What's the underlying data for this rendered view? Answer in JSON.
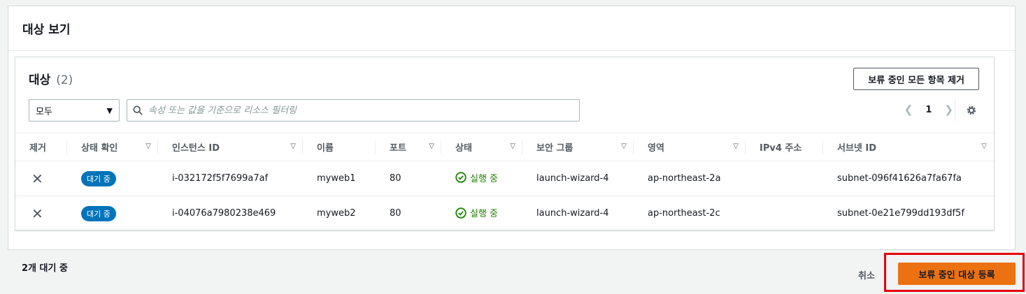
{
  "section": {
    "title": "대상 보기"
  },
  "targets": {
    "title": "대상",
    "count": "(2)",
    "remove_all_label": "보류 중인 모든 항목 제거",
    "filter_select": "모두",
    "search_placeholder": "속성 또는 값을 기준으로 리소스 필터링",
    "page": "1",
    "columns": [
      "제거",
      "상태 확인",
      "인스턴스 ID",
      "이름",
      "포트",
      "상태",
      "보안 그룹",
      "영역",
      "IPv4 주소",
      "서브넷 ID"
    ],
    "rows": [
      {
        "health": "대기 중",
        "instance_id": "i-032172f5f7699a7af",
        "name": "myweb1",
        "port": "80",
        "state": "실행 중",
        "security_group": "launch-wizard-4",
        "zone": "ap-northeast-2a",
        "ipv4": "",
        "subnet": "subnet-096f41626a7fa67fa"
      },
      {
        "health": "대기 중",
        "instance_id": "i-04076a7980238e469",
        "name": "myweb2",
        "port": "80",
        "state": "실행 중",
        "security_group": "launch-wizard-4",
        "zone": "ap-northeast-2c",
        "ipv4": "",
        "subnet": "subnet-0e21e799dd193df5f"
      }
    ]
  },
  "footer": {
    "pending_text": "2개 대기 중",
    "cancel_label": "취소",
    "register_label": "보류 중인 대상 등록"
  },
  "colors": {
    "accent": "#ec7211",
    "badge": "#0073bb",
    "running": "#1d8102",
    "highlight": "#e8000b"
  }
}
